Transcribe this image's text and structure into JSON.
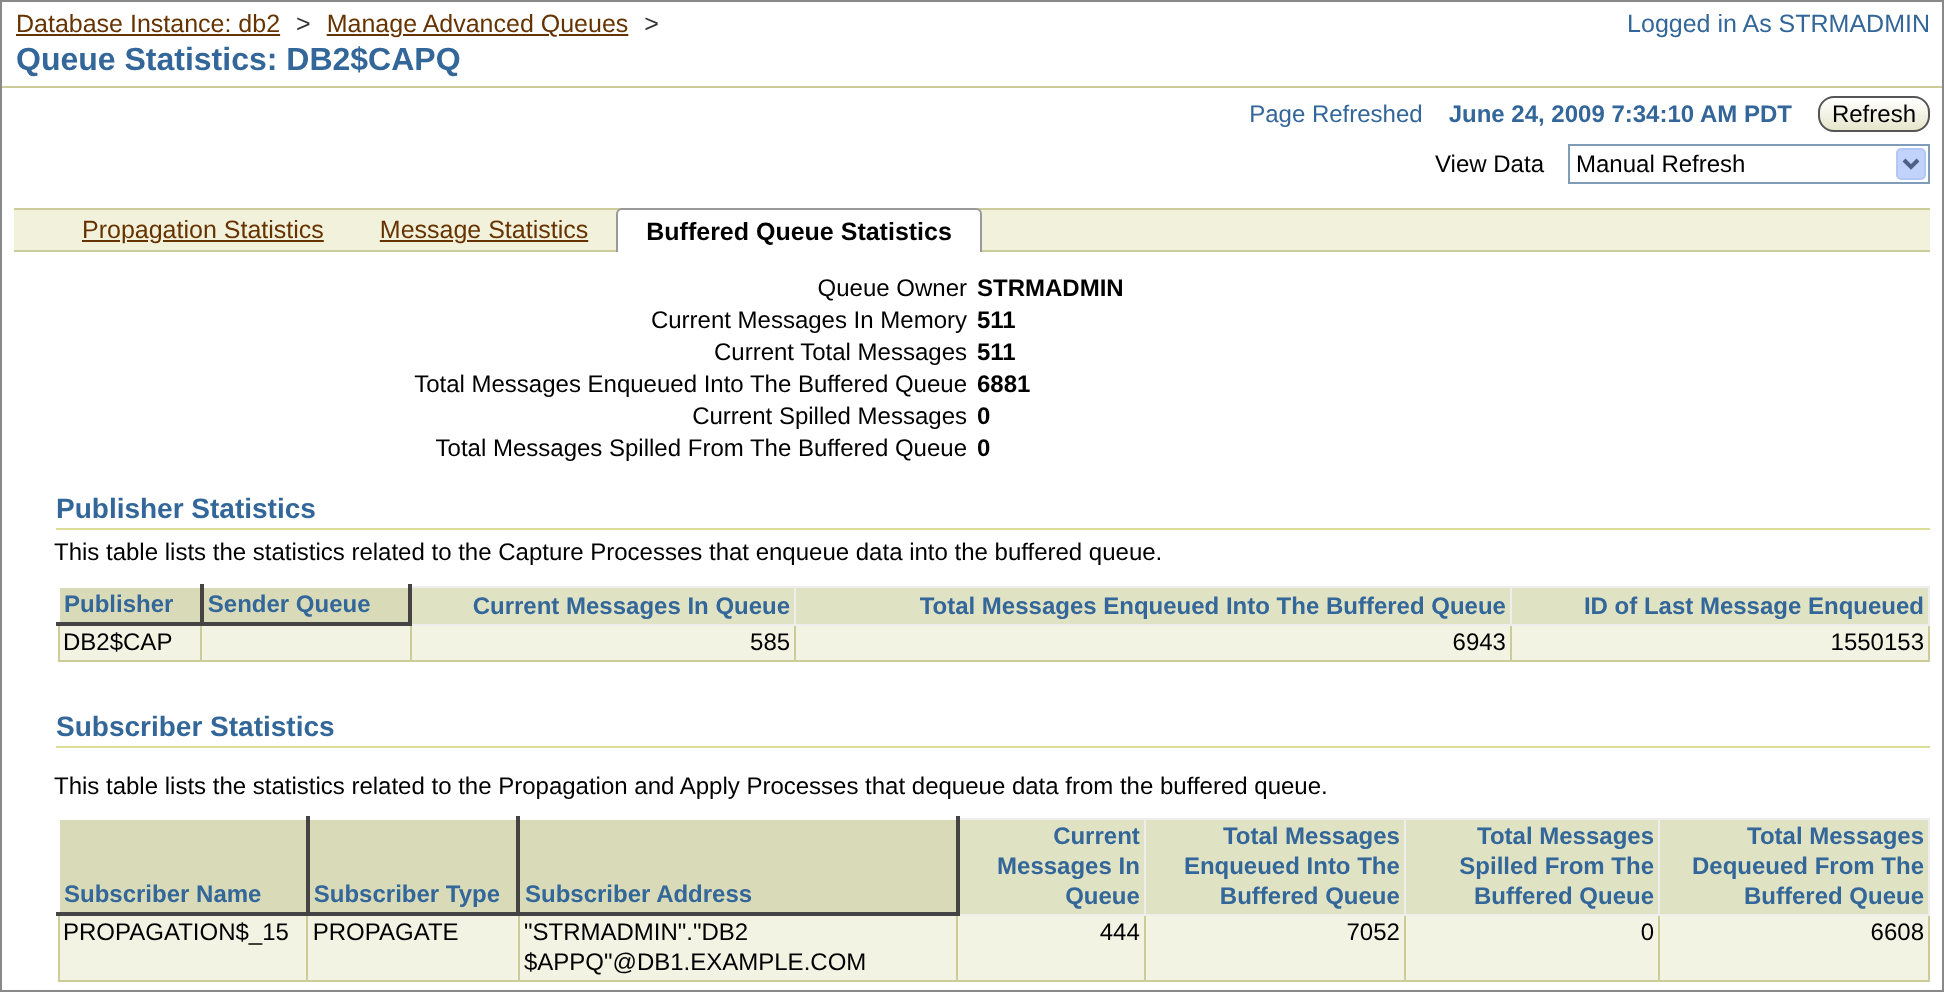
{
  "breadcrumbs": [
    {
      "label": "Database Instance: db2",
      "separator": ">"
    },
    {
      "label": "Manage Advanced Queues",
      "separator": ">"
    }
  ],
  "login": "Logged in As STRMADMIN",
  "title": "Queue Statistics: DB2$CAPQ",
  "refresh": {
    "label": "Page Refreshed",
    "value": "June 24, 2009 7:34:10 AM PDT",
    "button": "Refresh"
  },
  "view_data": {
    "label": "View Data",
    "value": "Manual Refresh"
  },
  "tabs": [
    {
      "label": "Propagation Statistics",
      "selected": false
    },
    {
      "label": "Message Statistics",
      "selected": false
    },
    {
      "label": "Buffered Queue Statistics",
      "selected": true
    }
  ],
  "queue_info": [
    {
      "label": "Queue Owner",
      "value": "STRMADMIN"
    },
    {
      "label": "Current Messages In Memory",
      "value": "511"
    },
    {
      "label": "Current Total Messages",
      "value": "511"
    },
    {
      "label": "Total Messages Enqueued Into The Buffered Queue",
      "value": "6881"
    },
    {
      "label": "Current Spilled Messages",
      "value": "0"
    },
    {
      "label": "Total Messages Spilled From The Buffered Queue",
      "value": "0"
    }
  ],
  "sections": [
    {
      "heading": "Publisher Statistics",
      "description": "This table lists the statistics related to the Capture Processes that enqueue data into the buffered queue.",
      "columns": [
        {
          "label": "Publisher",
          "sortable": true,
          "kind": "text"
        },
        {
          "label": "Sender Queue",
          "sortable": true,
          "kind": "text"
        },
        {
          "label": "Current Messages In Queue",
          "sortable": false,
          "kind": "number"
        },
        {
          "label": "Total Messages Enqueued Into The Buffered Queue",
          "sortable": false,
          "kind": "number"
        },
        {
          "label": "ID of Last Message Enqueued",
          "sortable": false,
          "kind": "number"
        }
      ],
      "rows": [
        [
          "DB2$CAP",
          "",
          "585",
          "6943",
          "1550153"
        ]
      ]
    },
    {
      "heading": "Subscriber Statistics",
      "description": "This table lists the statistics related to the Propagation and Apply Processes that dequeue data from the buffered queue.",
      "columns": [
        {
          "label": "Subscriber Name",
          "sortable": true,
          "kind": "text"
        },
        {
          "label": "Subscriber Type",
          "sortable": true,
          "kind": "text"
        },
        {
          "label": "Subscriber Address",
          "sortable": true,
          "kind": "text"
        },
        {
          "label": "Current Messages In Queue",
          "sortable": false,
          "kind": "number"
        },
        {
          "label": "Total Messages Enqueued Into The Buffered Queue",
          "sortable": false,
          "kind": "number"
        },
        {
          "label": "Total Messages Spilled From The Buffered Queue",
          "sortable": false,
          "kind": "number"
        },
        {
          "label": "Total Messages Dequeued From The Buffered Queue",
          "sortable": false,
          "kind": "number"
        }
      ],
      "rows": [
        [
          "PROPAGATION$_15",
          "PROPAGATE",
          "\"STRMADMIN\".\"DB2 $APPQ\"@DB1.EXAMPLE.COM",
          "444",
          "7052",
          "0",
          "6608"
        ]
      ]
    }
  ]
}
